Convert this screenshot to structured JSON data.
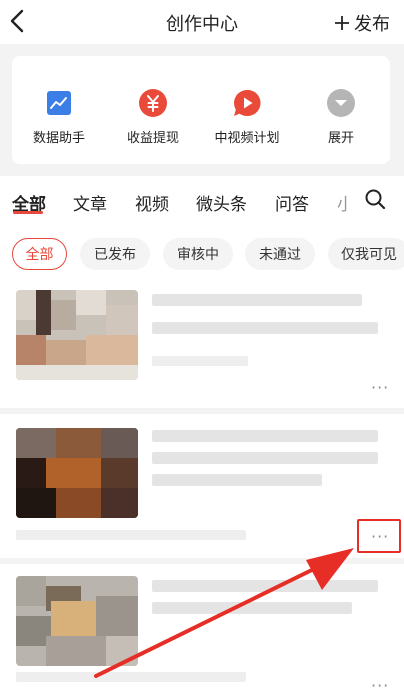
{
  "header": {
    "title": "创作中心",
    "publish_label": "发布"
  },
  "tools": [
    {
      "label": "数据助手",
      "icon": "chart-icon",
      "color": "#3a7ee6"
    },
    {
      "label": "收益提现",
      "icon": "yuan-icon",
      "color": "#ea4a3a"
    },
    {
      "label": "中视频计划",
      "icon": "play-icon",
      "color": "#ea4a3a"
    },
    {
      "label": "展开",
      "icon": "chevron-down-icon",
      "color": "#b5b5b5"
    }
  ],
  "tabs": [
    {
      "label": "全部",
      "active": true
    },
    {
      "label": "文章"
    },
    {
      "label": "视频"
    },
    {
      "label": "微头条"
    },
    {
      "label": "问答"
    },
    {
      "label": "小"
    }
  ],
  "filters": [
    {
      "label": "全部",
      "active": true
    },
    {
      "label": "已发布"
    },
    {
      "label": "审核中"
    },
    {
      "label": "未通过"
    },
    {
      "label": "仅我可见"
    }
  ],
  "content_items": [
    {
      "more_label": "···"
    },
    {
      "more_label": "···"
    },
    {
      "more_label": "···"
    }
  ],
  "colors": {
    "accent": "#e8483b",
    "annotation_red": "#e72e26"
  }
}
